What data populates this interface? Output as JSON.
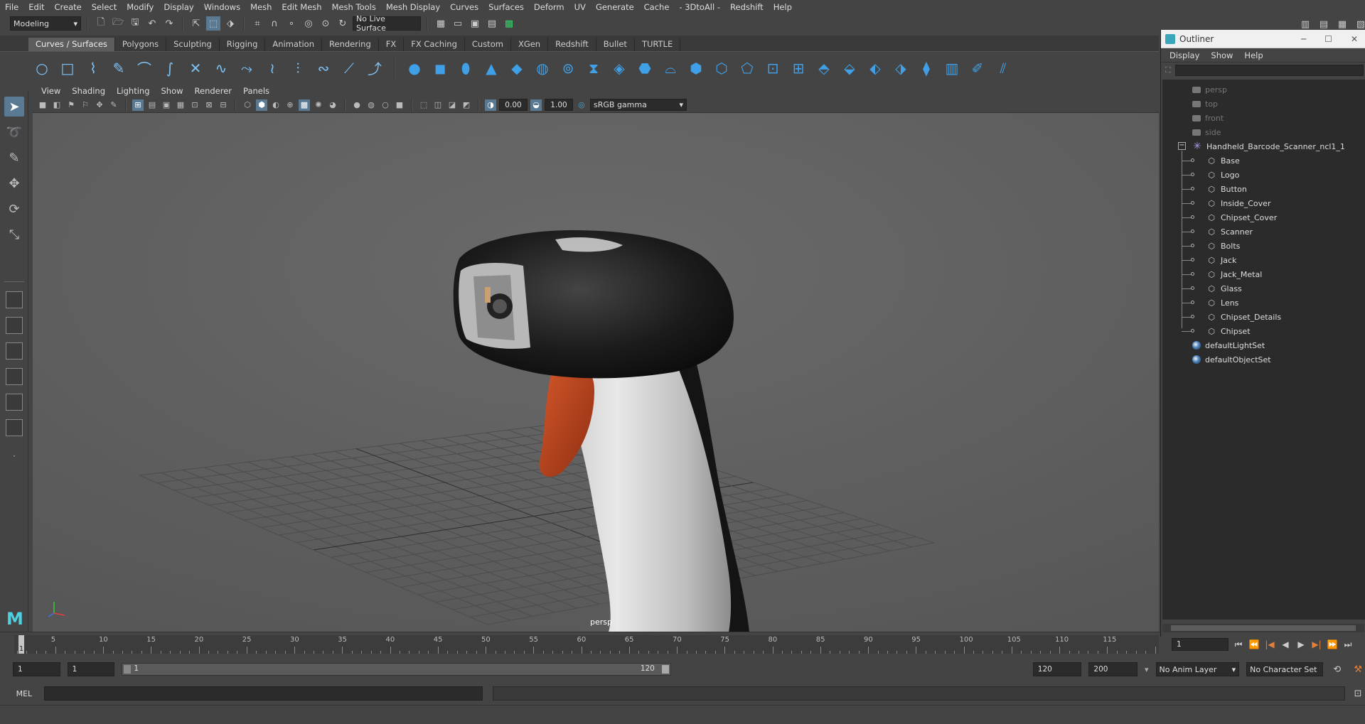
{
  "menubar": {
    "items": [
      "File",
      "Edit",
      "Create",
      "Select",
      "Modify",
      "Display",
      "Windows",
      "Mesh",
      "Edit Mesh",
      "Mesh Tools",
      "Mesh Display",
      "Curves",
      "Surfaces",
      "Deform",
      "UV",
      "Generate",
      "Cache",
      "- 3DtoAll -",
      "Redshift",
      "Help"
    ]
  },
  "statusline": {
    "menuset": "Modeling",
    "live_surface": "No Live Surface"
  },
  "shelf": {
    "tabs": [
      "Curves / Surfaces",
      "Polygons",
      "Sculpting",
      "Rigging",
      "Animation",
      "Rendering",
      "FX",
      "FX Caching",
      "Custom",
      "XGen",
      "Redshift",
      "Bullet",
      "TURTLE"
    ],
    "active_tab": "Curves / Surfaces"
  },
  "panel": {
    "menu": [
      "View",
      "Shading",
      "Lighting",
      "Show",
      "Renderer",
      "Panels"
    ],
    "exposure": "0.00",
    "gamma": "1.00",
    "colorspace": "sRGB gamma",
    "camera_label": "persp"
  },
  "timeline": {
    "ticks": [
      5,
      10,
      15,
      20,
      25,
      30,
      35,
      40,
      45,
      50,
      55,
      60,
      65,
      70,
      75,
      80,
      85,
      90,
      95,
      100,
      105,
      110,
      115
    ],
    "playhead_label": "1",
    "current_frame": "1"
  },
  "range": {
    "start": "1",
    "playback_start": "1",
    "slider_start": "1",
    "slider_end": "120",
    "playback_end": "120",
    "end": "200",
    "anim_layer": "No Anim Layer",
    "character_set": "No Character Set"
  },
  "cmdline": {
    "language": "MEL"
  },
  "outliner": {
    "title": "Outliner",
    "menu": [
      "Display",
      "Show",
      "Help"
    ],
    "cameras": [
      "persp",
      "top",
      "front",
      "side"
    ],
    "group": "Handheld_Barcode_Scanner_ncl1_1",
    "children": [
      "Base",
      "Logo",
      "Button",
      "Inside_Cover",
      "Chipset_Cover",
      "Scanner",
      "Bolts",
      "Jack",
      "Jack_Metal",
      "Glass",
      "Lens",
      "Chipset_Details",
      "Chipset"
    ],
    "sets": [
      "defaultLightSet",
      "defaultObjectSet"
    ]
  },
  "colors": {
    "viewport_bg": "#5e5e5e",
    "accent_active": "#5a7a94",
    "scanner_orange": "#c04a22",
    "shelf_curve": "#7ec2f5",
    "shelf_poly": "#3fa0e8"
  }
}
